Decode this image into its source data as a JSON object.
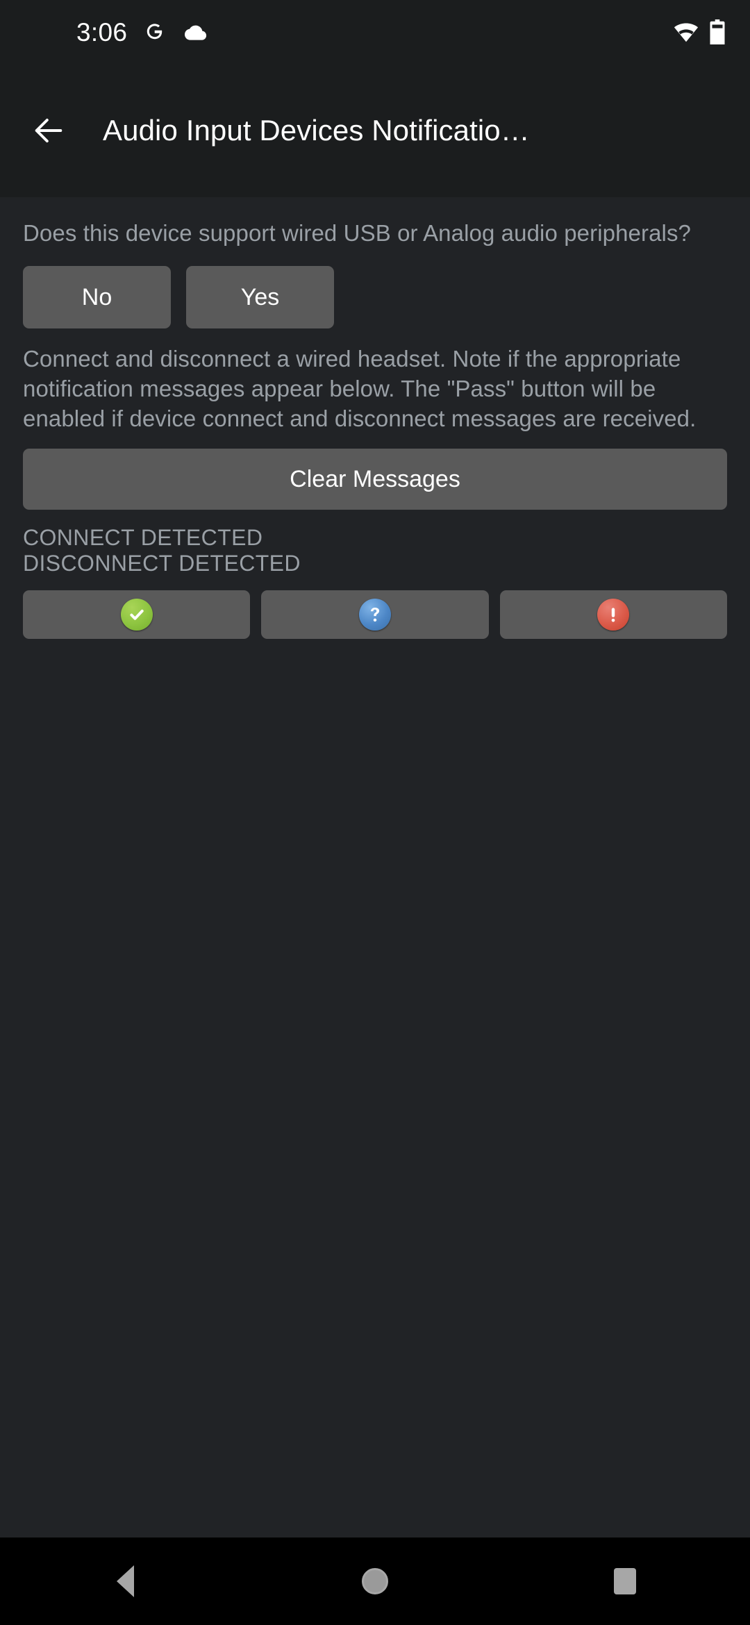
{
  "status_bar": {
    "clock": "3:06",
    "left_icons": [
      "google-g-icon",
      "cloud-icon"
    ],
    "right_icons": [
      "wifi-icon",
      "battery-icon"
    ]
  },
  "app_bar": {
    "back_icon": "back-arrow-icon",
    "title": "Audio Input Devices Notificatio…"
  },
  "main": {
    "question": "Does this device support wired USB or Analog audio peripherals?",
    "answer_buttons": [
      {
        "label": "No",
        "name": "no-button"
      },
      {
        "label": "Yes",
        "name": "yes-button"
      }
    ],
    "instructions": "Connect and disconnect a wired headset. Note if the appropriate notification messages appear below. The \"Pass\" button will be enabled if device connect and disconnect messages are received.",
    "clear_button_label": "Clear Messages",
    "status_lines": [
      "CONNECT DETECTED",
      "DISCONNECT DETECTED"
    ],
    "verdict_buttons": [
      {
        "name": "pass-button",
        "icon": "check-circle-icon",
        "color": "#8dc440"
      },
      {
        "name": "info-button",
        "icon": "question-circle-icon",
        "color": "#4d87c7"
      },
      {
        "name": "fail-button",
        "icon": "exclamation-circle-icon",
        "color": "#db5a49"
      }
    ]
  },
  "nav_bar": {
    "back": "triangle-back-icon",
    "home": "circle-home-icon",
    "recents": "square-recents-icon"
  },
  "colors": {
    "background": "#212326",
    "bar_background": "#1b1d1e",
    "button": "#5a5a5a",
    "text_primary": "#ffffff",
    "text_secondary": "#9aa0a6",
    "nav_background": "#000000"
  }
}
